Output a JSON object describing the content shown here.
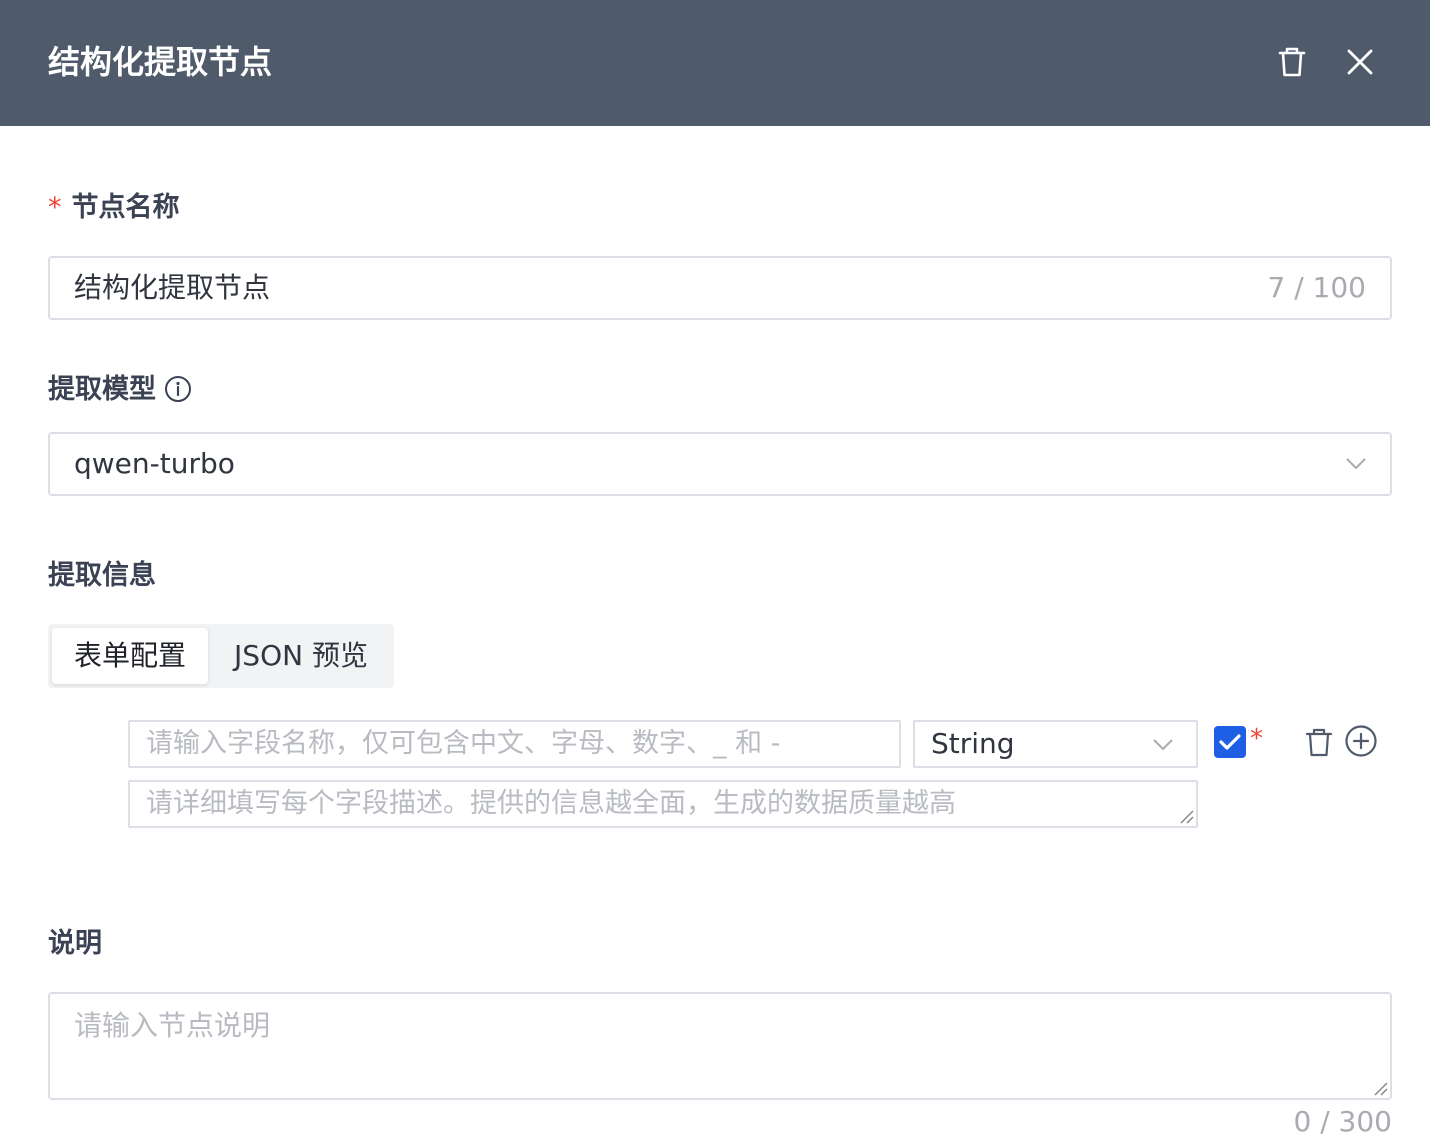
{
  "dialog": {
    "title": "结构化提取节点"
  },
  "node_name": {
    "label": "节点名称",
    "required_mark": "*",
    "value": "结构化提取节点",
    "counter": "7 / 100"
  },
  "extract_model": {
    "label": "提取模型",
    "value": "qwen-turbo"
  },
  "extract_info": {
    "label": "提取信息",
    "tabs": [
      {
        "label": "表单配置",
        "active": true
      },
      {
        "label": "JSON 预览",
        "active": false
      }
    ],
    "fields": [
      {
        "name_placeholder": "请输入字段名称，仅可包含中文、字母、数字、_ 和 -",
        "type": "String",
        "required": true,
        "required_mark": "*",
        "description_placeholder": "请详细填写每个字段描述。提供的信息越全面，生成的数据质量越高"
      }
    ]
  },
  "description": {
    "label": "说明",
    "placeholder": "请输入节点说明",
    "counter": "0 / 300"
  },
  "colors": {
    "header_bg": "#4f5a6b",
    "accent": "#1f5fe5",
    "required": "#f04134"
  }
}
